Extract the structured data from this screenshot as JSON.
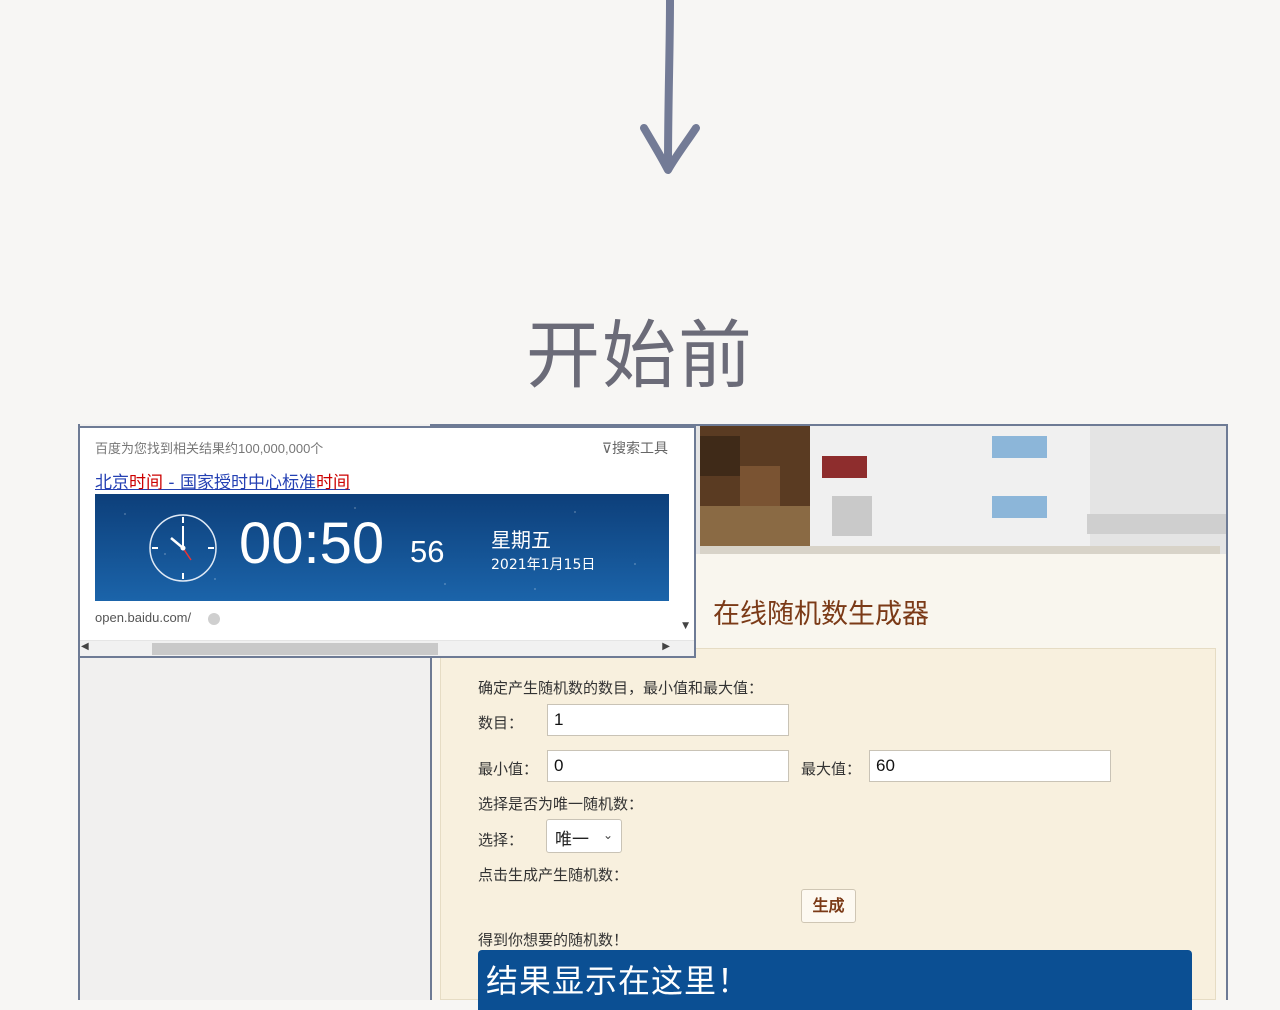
{
  "heading": "开始前",
  "baidu": {
    "result_count": "百度为您找到相关结果约100,000,000个",
    "search_tools": "搜索工具",
    "title_part1": "北京",
    "title_part2": "时间",
    "title_part3": " - 国家授时中心标准",
    "title_part4": "时间",
    "time": "00:50",
    "seconds": "56",
    "weekday": "星期五",
    "date": "2021年1月15日",
    "url": "open.baidu.com/"
  },
  "generator": {
    "title": "在线随机数生成器",
    "intro": "确定产生随机数的数目，最小值和最大值：",
    "count_label": "数目：",
    "count_value": "1",
    "min_label": "最小值：",
    "min_value": "0",
    "max_label": "最大值：",
    "max_value": "60",
    "unique_prompt": "选择是否为唯一随机数：",
    "select_label": "选择：",
    "select_value": "唯一",
    "generate_prompt": "点击生成产生随机数：",
    "generate_button": "生成",
    "result_prompt": "得到你想要的随机数！",
    "result_text": "结果显示在这里！"
  }
}
